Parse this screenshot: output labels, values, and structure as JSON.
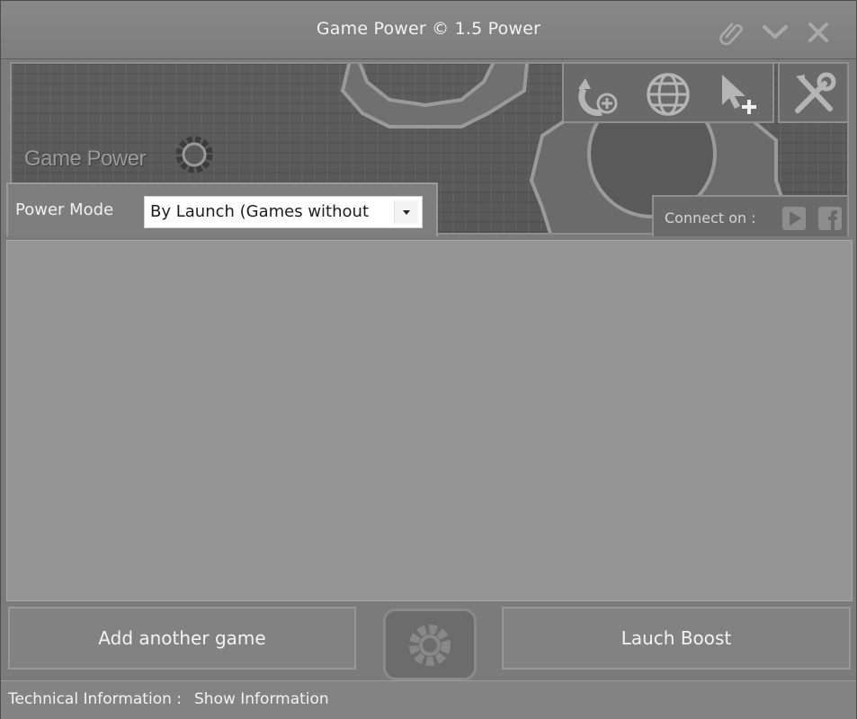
{
  "window": {
    "title": "Game Power © 1.5 Power",
    "title_icons": [
      "paperclip-icon",
      "chevron-down-icon",
      "close-icon"
    ]
  },
  "banner": {
    "brand_text": "Game Power",
    "tools": [
      "refresh-add-icon",
      "globe-icon",
      "cursor-add-icon"
    ],
    "settings_icon": "tools-icon",
    "connect_label": "Connect on :",
    "social_icons": [
      "youtube-icon",
      "facebook-icon"
    ]
  },
  "power_mode": {
    "label": "Power Mode",
    "selected": "By Launch (Games without"
  },
  "buttons": {
    "add_game": "Add another game",
    "launch_boost": "Lauch Boost"
  },
  "status_bar": {
    "label": "Technical Information :",
    "link": "Show Information"
  },
  "colors": {
    "window_bg": "#7b7b7b",
    "list_bg": "#959595",
    "text": "#f2f2f2"
  }
}
